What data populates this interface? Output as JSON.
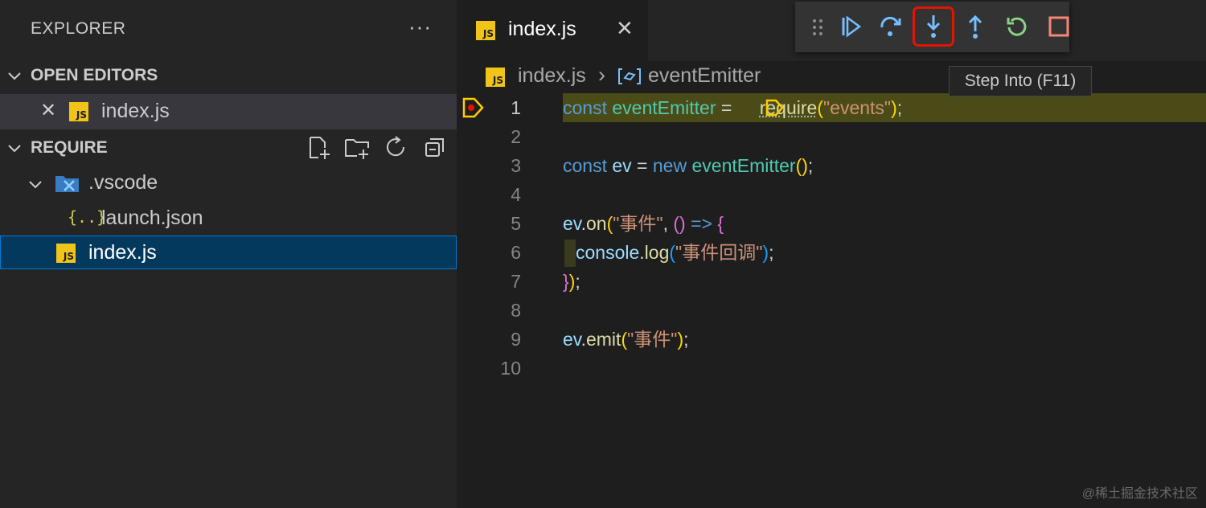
{
  "sidebar": {
    "title": "EXPLORER",
    "more": "···",
    "open_editors": {
      "label": "OPEN EDITORS",
      "items": [
        {
          "name": "index.js",
          "close": "✕"
        }
      ]
    },
    "folder": {
      "label": "REQUIRE",
      "tree": [
        {
          "name": ".vscode",
          "kind": "folder",
          "expanded": true
        },
        {
          "name": "launch.json",
          "kind": "json",
          "icon_text": "{..}"
        },
        {
          "name": "index.js",
          "kind": "js",
          "selected": true
        }
      ]
    }
  },
  "tabs": [
    {
      "name": "index.js",
      "close": "✕",
      "active": true
    }
  ],
  "breadcrumb": {
    "file": "index.js",
    "sep": "›",
    "symbol": "eventEmitter"
  },
  "js_badge": "JS",
  "debug_toolbar": {
    "buttons": [
      "continue",
      "step-over",
      "step-into",
      "step-out",
      "restart",
      "stop"
    ],
    "highlighted": "step-into",
    "tooltip": "Step Into (F11)"
  },
  "editor": {
    "line_numbers": [
      "1",
      "2",
      "3",
      "4",
      "5",
      "6",
      "7",
      "8",
      "9",
      "10"
    ],
    "current_line": "1",
    "lines": {
      "l1": {
        "const": "const",
        "name": "eventEmitter",
        "eq": " = ",
        "require": "require",
        "po": "(",
        "str": "\"events\"",
        "pc": ")",
        "semi": ";"
      },
      "l3": {
        "const": "const",
        "ev": "ev",
        "eq": " = ",
        "new": "new",
        "cls": "eventEmitter",
        "args": "()",
        "semi": ";"
      },
      "l5": {
        "ev": "ev",
        "dot": ".",
        "on": "on",
        "po": "(",
        "str": "\"事件\"",
        "comma": ", ",
        "args": "()",
        "arrow": " => ",
        "brace": "{"
      },
      "l6": {
        "console": "console",
        "dot": ".",
        "log": "log",
        "po": "(",
        "str": "\"事件回调\"",
        "pc": ")",
        "semi": ";"
      },
      "l7": {
        "brace": "}",
        "pc": ")",
        "semi": ";"
      },
      "l9": {
        "ev": "ev",
        "dot": ".",
        "emit": "emit",
        "po": "(",
        "str": "\"事件\"",
        "pc": ")",
        "semi": ";"
      }
    }
  },
  "watermark": "@稀土掘金技术社区",
  "colors": {
    "accent_blue": "#75beff",
    "restart_green": "#89d185",
    "stop_red": "#f48771",
    "highlight_box": "#e51400",
    "current_line_bg": "#4b4b18",
    "breakpoint": "#e51400",
    "arrow_yellow": "#ffcc00"
  }
}
